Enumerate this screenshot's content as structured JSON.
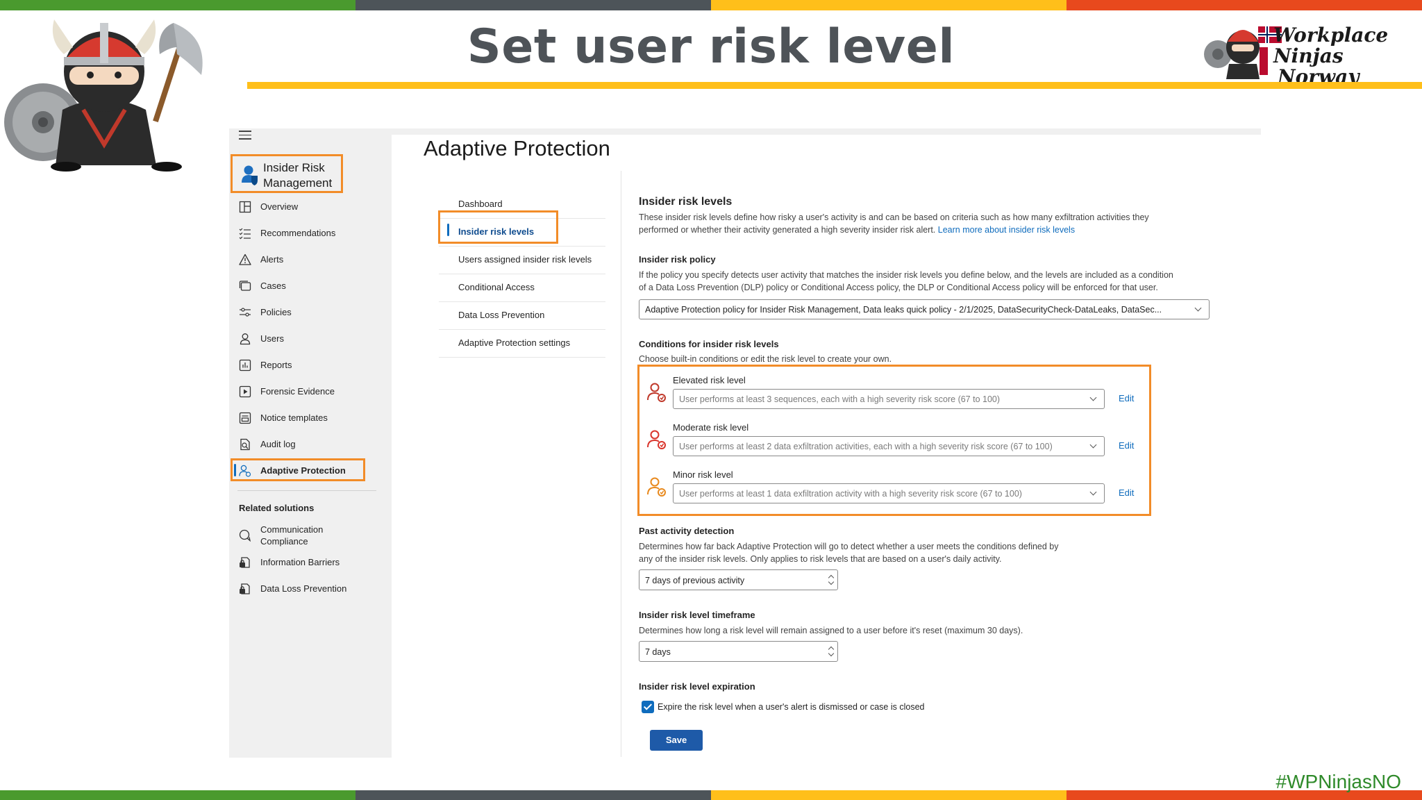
{
  "slide": {
    "title": "Set user risk level",
    "logo_text_line1": "Workplace Ninjas",
    "logo_text_line2": "Norway",
    "hashtag": "#WPNinjasNO",
    "bar_colors": [
      "#4a9a2e",
      "#4d5459",
      "#ffbf1a",
      "#e8491d"
    ]
  },
  "sidebar": {
    "app_title": "Insider Risk Management",
    "items": [
      {
        "label": "Overview",
        "icon": "overview-icon"
      },
      {
        "label": "Recommendations",
        "icon": "checklist-icon"
      },
      {
        "label": "Alerts",
        "icon": "warning-icon"
      },
      {
        "label": "Cases",
        "icon": "cases-icon"
      },
      {
        "label": "Policies",
        "icon": "sliders-icon"
      },
      {
        "label": "Users",
        "icon": "user-icon"
      },
      {
        "label": "Reports",
        "icon": "report-icon"
      },
      {
        "label": "Forensic Evidence",
        "icon": "play-icon"
      },
      {
        "label": "Notice templates",
        "icon": "template-icon"
      },
      {
        "label": "Audit log",
        "icon": "audit-icon"
      },
      {
        "label": "Adaptive Protection",
        "icon": "adaptive-user-icon"
      }
    ],
    "related_title": "Related solutions",
    "related_items": [
      {
        "label": "Communication Compliance",
        "icon": "chat-icon"
      },
      {
        "label": "Information Barriers",
        "icon": "barrier-lock-icon"
      },
      {
        "label": "Data Loss Prevention",
        "icon": "dlp-lock-icon"
      }
    ]
  },
  "page": {
    "title": "Adaptive Protection",
    "subnav": [
      "Dashboard",
      "Insider risk levels",
      "Users assigned insider risk levels",
      "Conditional Access",
      "Data Loss Prevention",
      "Adaptive Protection settings"
    ],
    "active_subnav": "Insider risk levels"
  },
  "settings": {
    "levels_title": "Insider risk levels",
    "levels_desc_1": "These insider risk levels define how risky a user's activity is and can be based on criteria such as how many exfiltration activities they",
    "levels_desc_2": "performed or whether their activity generated a high severity insider risk alert.",
    "learn_more": "Learn more about insider risk levels",
    "policy_title": "Insider risk policy",
    "policy_desc_1": "If the policy you specify detects user activity that matches the insider risk levels you define below, and the levels are included as a condition",
    "policy_desc_2": "of a Data Loss Prevention (DLP) policy or Conditional Access policy, the DLP or Conditional Access policy will be enforced for that user.",
    "policy_value": "Adaptive Protection policy for Insider Risk Management, Data leaks quick policy - 2/1/2025, DataSecurityCheck-DataLeaks, DataSec...",
    "conditions_title": "Conditions for insider risk levels",
    "conditions_desc": "Choose built-in conditions or edit the risk level to create your own.",
    "risk_levels": [
      {
        "label": "Elevated risk level",
        "value": "User performs at least 3 sequences, each with a high severity risk score (67 to 100)",
        "edit": "Edit",
        "color": "#c0392b"
      },
      {
        "label": "Moderate risk level",
        "value": "User performs at least 2 data exfiltration activities, each with a high severity risk score (67 to 100)",
        "edit": "Edit",
        "color": "#d9342b"
      },
      {
        "label": "Minor risk level",
        "value": "User performs at least 1 data exfiltration activity with a high severity risk score (67 to 100)",
        "edit": "Edit",
        "color": "#e8891d"
      }
    ],
    "past_title": "Past activity detection",
    "past_desc_1": "Determines how far back Adaptive Protection will go to detect whether a user meets the conditions defined by",
    "past_desc_2": "any of the insider risk levels. Only applies to risk levels that are based on a user's daily activity.",
    "past_value": "7 days of previous activity",
    "timeframe_title": "Insider risk level timeframe",
    "timeframe_desc": "Determines how long a risk level will remain assigned to a user before it's reset (maximum 30 days).",
    "timeframe_value": "7 days",
    "expiration_title": "Insider risk level expiration",
    "expiration_checkbox": "Expire the risk level when a user's alert is dismissed or case is closed",
    "expiration_checked": true,
    "save_label": "Save"
  }
}
